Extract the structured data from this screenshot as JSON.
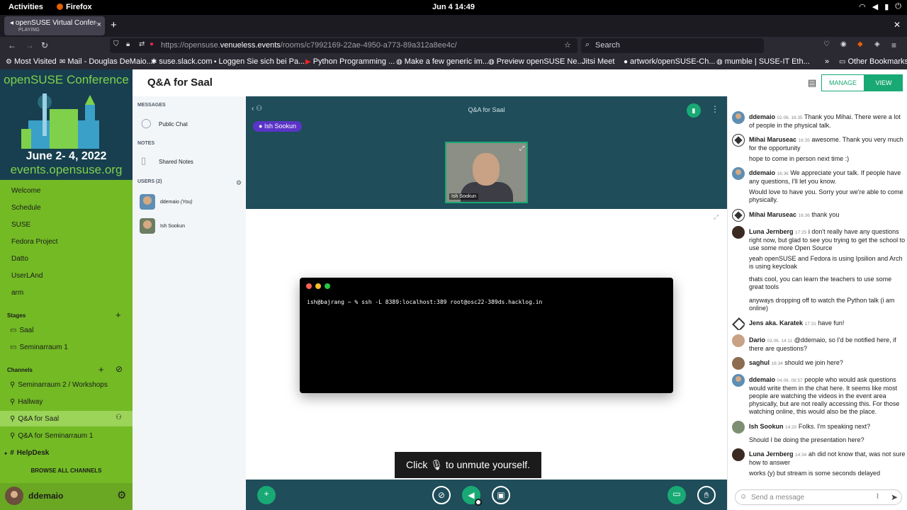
{
  "system": {
    "activities": "Activities",
    "app": "Firefox",
    "clock": "Jun 4  14:49"
  },
  "browser": {
    "tab_title": "openSUSE Virtual Confere",
    "tab_status": "PLAYING",
    "url_prefix": "https://opensuse.",
    "url_domain": "venueless.events",
    "url_path": "/rooms/c7992169-22ae-4950-a773-89a312a8ee4c/",
    "search_placeholder": "Search",
    "bookmarks": [
      "Most Visited",
      "Mail - Douglas DeMaio...",
      "suse.slack.com",
      "Loggen Sie sich bei Pa...",
      "Python Programming ...",
      "Make a few generic im...",
      "Preview openSUSE Ne...",
      "Jitsi Meet",
      "artwork/openSUSE-Ch...",
      "mumble | SUSE-IT Eth...",
      "Other Bookmarks"
    ]
  },
  "sidebar": {
    "banner_title": "openSUSE Conference",
    "banner_dates": "June 2- 4, 2022",
    "banner_site": "events.opensuse.org",
    "nav": [
      "Welcome",
      "Schedule",
      "SUSE",
      "Fedora Project",
      "Datto",
      "UserLAnd",
      "arm"
    ],
    "stages_label": "Stages",
    "stages": [
      "Saal",
      "Seminarraum 1"
    ],
    "channels_label": "Channels",
    "channels": [
      "Seminarraum 2 / Workshops",
      "Hallway",
      "Q&A for Saal",
      "Q&A for Seminarraum 1",
      "HelpDesk"
    ],
    "browse_all": "BROWSE ALL CHANNELS",
    "username": "ddemaio"
  },
  "room": {
    "title": "Q&A for Saal",
    "manage": "MANAGE",
    "view": "VIEW"
  },
  "bbb": {
    "messages_label": "MESSAGES",
    "public_chat": "Public Chat",
    "notes_label": "NOTES",
    "shared_notes": "Shared Notes",
    "users_label": "USERS (2)",
    "user1": "ddemaio",
    "user1_suffix": "(You)",
    "user2": "Ish Sookun",
    "meeting_title": "Q&A for Saal",
    "presenter_tag": "Ish Sookun",
    "webcam_label": "Ish Sookun",
    "terminal_line": "ish@bajrang ~ % ssh -L 8389:localhost:389 root@osc22-389ds.hacklog.in",
    "tooltip_before": "Click",
    "tooltip_after": "to unmute yourself."
  },
  "chat": {
    "messages": [
      {
        "name": "ddemaio",
        "ts": "02.06. 16:35",
        "text": "Thank you Mihai. There were a lot of people in the physical talk."
      },
      {
        "name": "Mihai Maruseac",
        "ts": "16:35",
        "text": "awesome. Thank you very much for the opportunity"
      },
      {
        "text": "hope to come in person next time :)"
      },
      {
        "name": "ddemaio",
        "ts": "16:36",
        "text": "We appreciate your talk. If people have any questions, I'll let you know."
      },
      {
        "text": "Would love to have you. Sorry your we're able to come physically."
      },
      {
        "name": "Mihai Maruseac",
        "ts": "16:36",
        "text": "thank you"
      },
      {
        "name": "Luna Jernberg",
        "ts": "17:25",
        "text": "i don't really have any questions right now, but glad to see you trying to get the school to use some more Open Source"
      },
      {
        "text": "yeah openSUSE and Fedora is using Ipsilion and Arch is using keycloak"
      },
      {
        "text": "thats cool, you can learn the teachers to use some great tools"
      },
      {
        "text": "anyways dropping off to watch the Python talk (i am online)"
      },
      {
        "name": "Jens aka. Karatek",
        "ts": "17:31",
        "text": "have fun!"
      },
      {
        "name": "Dario",
        "ts": "03.06. 14:11",
        "text": "@ddemaio, so I'd be notified here, if there are questions?"
      },
      {
        "name": "saghul",
        "ts": "16:34",
        "text": "should we join here?"
      },
      {
        "name": "ddemaio",
        "ts": "04.06. 08:57",
        "text": "people who would ask questions would write them in the chat here. It seems like most people are watching the videos in the event area physically, but are not really accessing this. For those watching online, this would also be the place."
      },
      {
        "name": "Ish Sookun",
        "ts": "14:20",
        "text": "Folks. I'm speaking next?"
      },
      {
        "text": "Should I be doing the presentation here?"
      },
      {
        "name": "Luna Jernberg",
        "ts": "14:34",
        "text": "ah did not know that, was not sure how to answer"
      },
      {
        "text": "works (y) but stream is some seconds delayed"
      }
    ],
    "input_placeholder": "Send a message"
  },
  "colors": {
    "accent": "#19a974",
    "sidebar": "#73ba25",
    "stage": "#1f4d5a"
  }
}
